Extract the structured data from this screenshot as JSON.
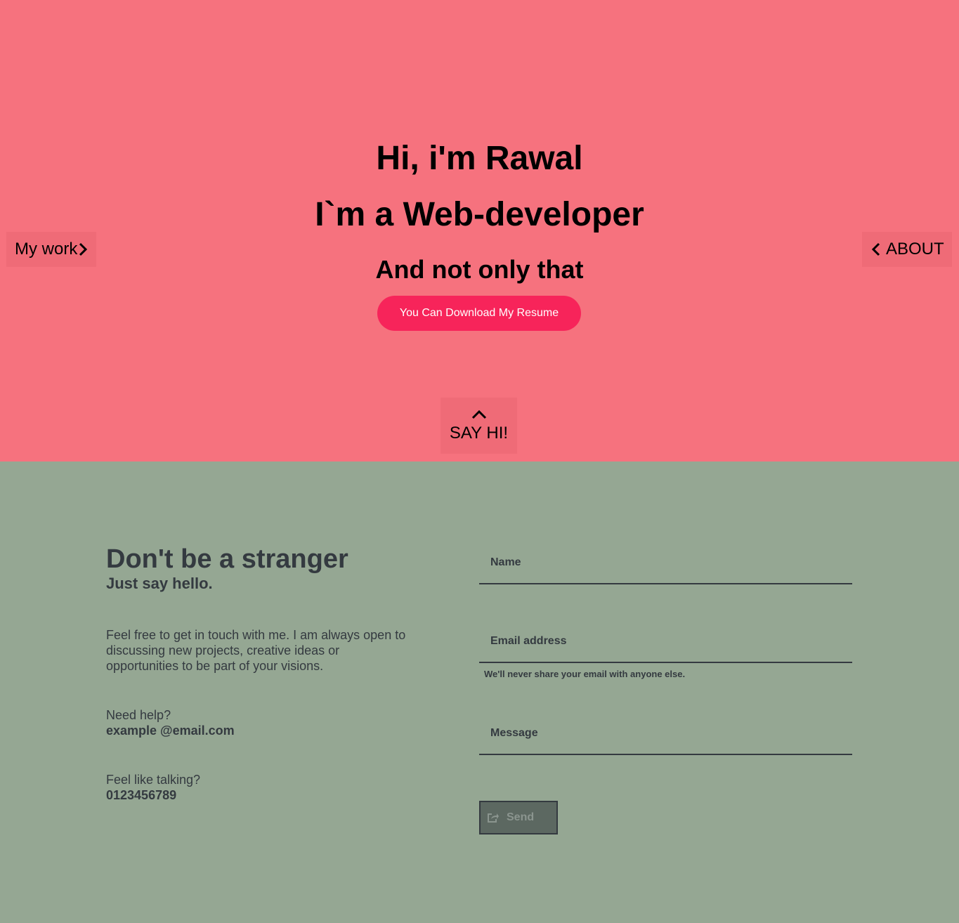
{
  "hero": {
    "greeting": "Hi, i'm Rawal",
    "role": "I`m a Web-developer",
    "tagline": "And not only that",
    "resume_button": "You Can Download My Resume",
    "left_nav_label": "My work",
    "right_nav_label": "ABOUT",
    "say_hi_label": "SAY HI!",
    "icons": {
      "left_nav": "chevron-right-icon",
      "right_nav": "chevron-left-icon",
      "say_hi": "chevron-up-icon"
    },
    "colors": {
      "background": "#f6727e",
      "resume_button": "#f7245a"
    }
  },
  "contact": {
    "heading": "Don't be a stranger",
    "subheading": "Just say hello.",
    "intro": "Feel free to get in touch with me. I am always open to discussing new projects, creative ideas or opportunities to be part of your visions.",
    "help_label": "Need help?",
    "email": "example @email.com",
    "talk_label": "Feel like talking?",
    "phone": "0123456789",
    "form": {
      "name_placeholder": "Name",
      "email_placeholder": "Email address",
      "email_hint": "We'll never share your email with anyone else.",
      "message_placeholder": "Message",
      "send_label": "Send",
      "send_icon": "share-icon"
    },
    "colors": {
      "background": "#95a793",
      "text": "#343a40"
    }
  }
}
